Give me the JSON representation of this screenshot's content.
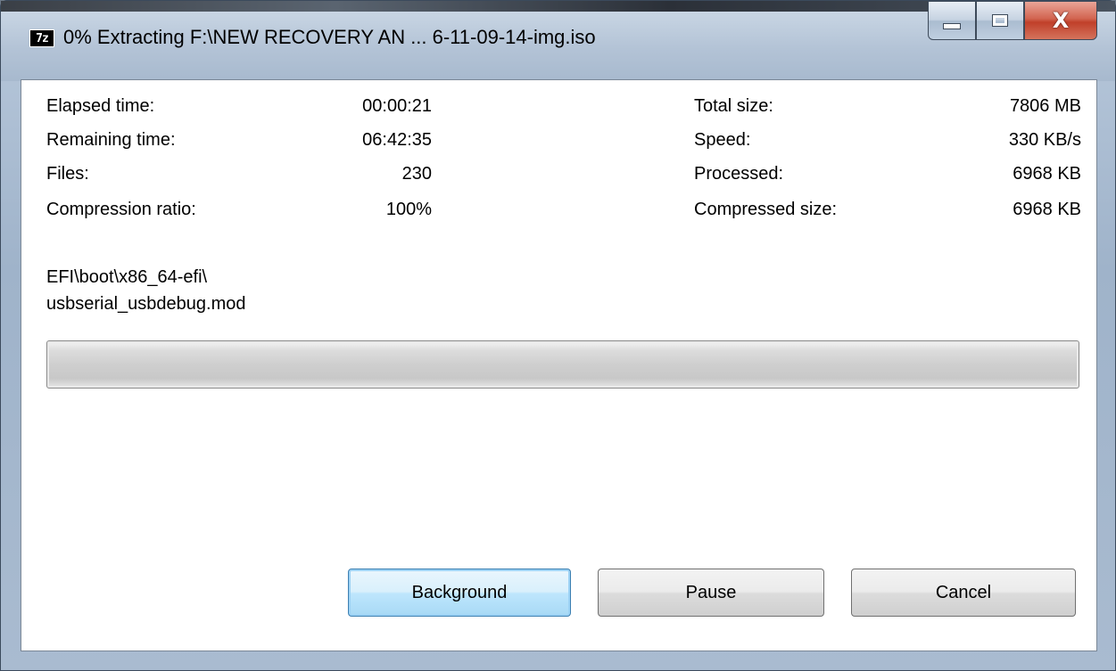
{
  "window": {
    "icon_text": "7z",
    "title": "0% Extracting F:\\NEW RECOVERY AN ... 6-11-09-14-img.iso",
    "controls": {
      "minimize_icon": "minimize-icon",
      "maximize_icon": "maximize-icon",
      "close_icon": "close-icon",
      "close_glyph": "X"
    }
  },
  "stats": {
    "left": [
      {
        "label": "Elapsed time:",
        "value": "00:00:21"
      },
      {
        "label": "Remaining time:",
        "value": "06:42:35"
      },
      {
        "label": "Files:",
        "value": "230"
      },
      {
        "label": "Compression ratio:",
        "value": "100%"
      }
    ],
    "right": [
      {
        "label": "Total size:",
        "value": "7806 MB"
      },
      {
        "label": "Speed:",
        "value": "330 KB/s"
      },
      {
        "label": "Processed:",
        "value": "6968 KB"
      },
      {
        "label": "Compressed size:",
        "value": "6968 KB"
      }
    ]
  },
  "current_file": {
    "folder": "EFI\\boot\\x86_64-efi\\",
    "name": "usbserial_usbdebug.mod"
  },
  "progress": {
    "fraction": 0.0
  },
  "buttons": {
    "background": "Background",
    "pause": "Pause",
    "cancel": "Cancel"
  },
  "colors": {
    "progress_fill": "#37c027",
    "default_button_border": "#3c7fb1",
    "close_button": "#c0402a"
  }
}
